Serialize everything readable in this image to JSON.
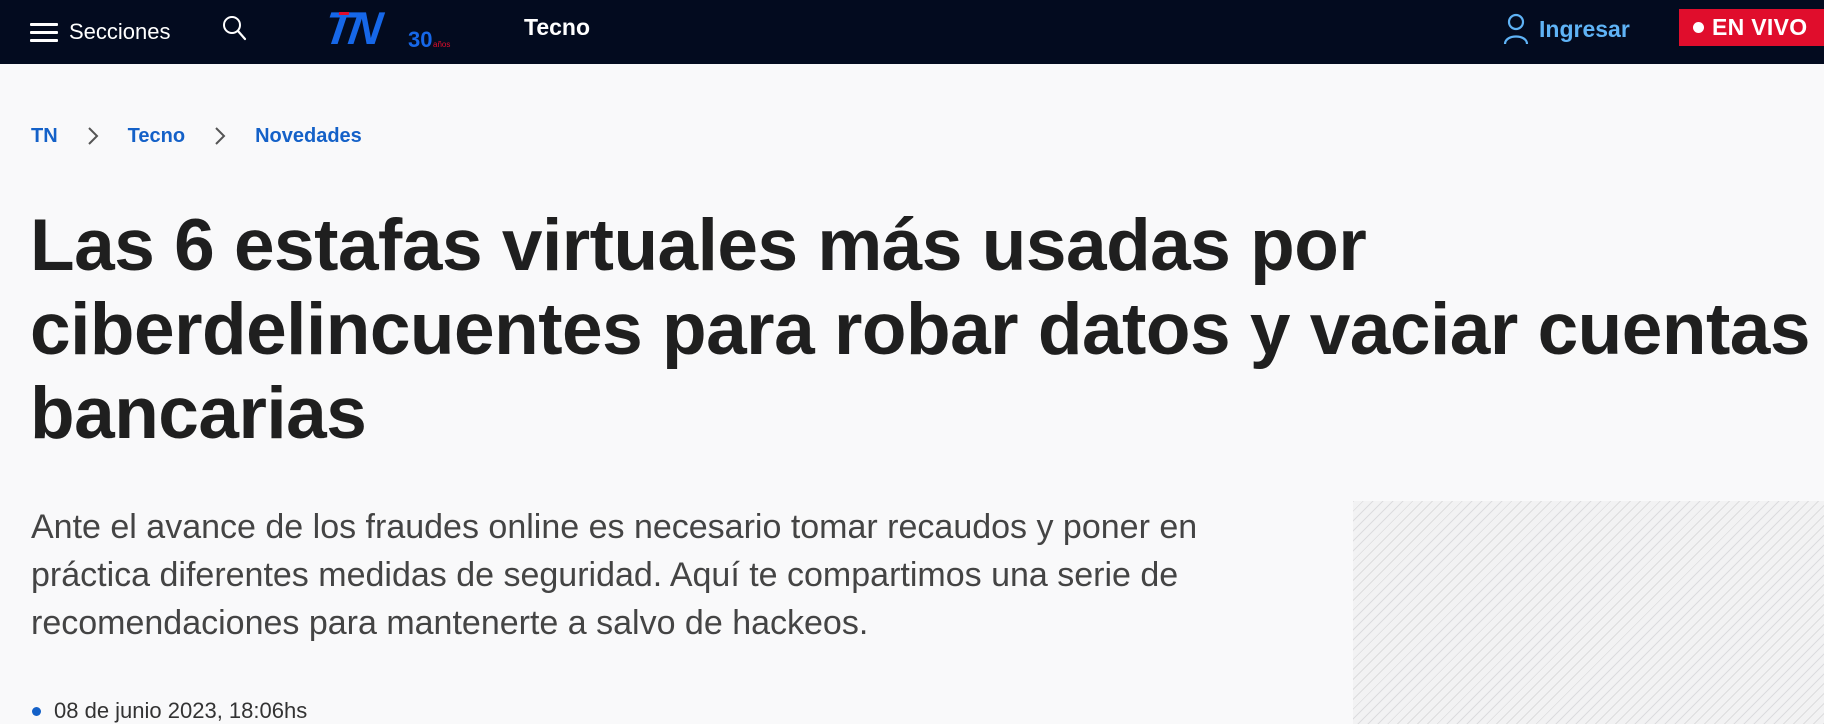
{
  "header": {
    "menu_label": "Secciones",
    "logo_text": "TN",
    "logo_badge": "30",
    "logo_badge_sub": "años",
    "section": "Tecno",
    "login_label": "Ingresar",
    "live_label": "EN VIVO"
  },
  "breadcrumb": [
    {
      "label": "TN"
    },
    {
      "label": "Tecno"
    },
    {
      "label": "Novedades"
    }
  ],
  "article": {
    "title": "Las 6 estafas virtuales más usadas por ciberdelincuentes para robar datos y vaciar cuentas bancarias",
    "lead": "Ante el avance de los fraudes online es necesario tomar recaudos y poner en práctica diferentes medidas de seguridad. Aquí te compartimos una serie de recomendaciones para mantenerte a salvo de hackeos.",
    "date": "08 de junio 2023, 18:06hs"
  },
  "colors": {
    "header_bg": "#030b1f",
    "accent_blue": "#1461c8",
    "login_blue": "#5fb3f6",
    "live_red": "#e00d2c"
  },
  "icons": [
    "menu-icon",
    "search-icon",
    "user-icon",
    "chevron-right-icon",
    "live-dot-icon"
  ]
}
